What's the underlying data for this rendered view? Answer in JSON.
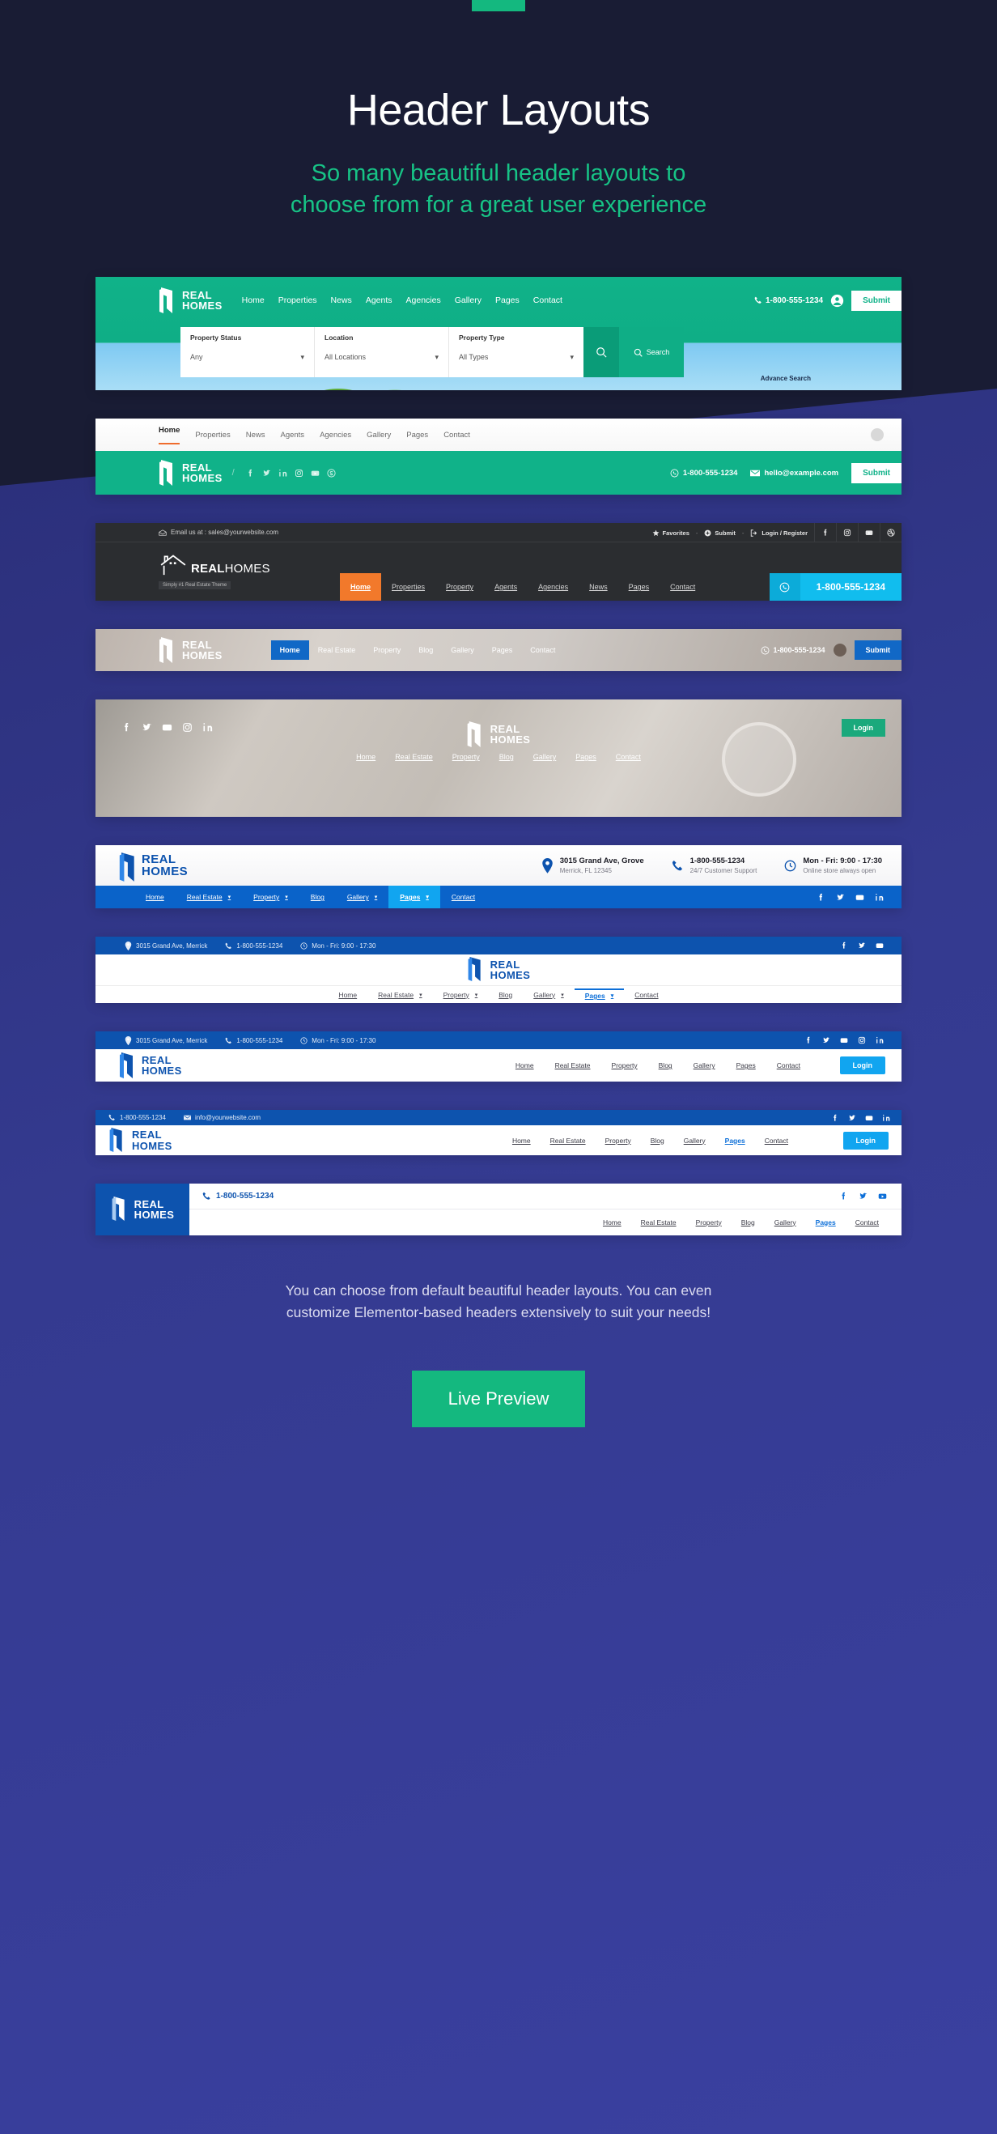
{
  "theme": {
    "accent_green": "#14b87f",
    "dark_bg": "#191c34",
    "blue_bg": "#333a92",
    "brand_blue": "#0d53ae"
  },
  "hero": {
    "title": "Header Layouts",
    "subtitle_line1": "So many beautiful header layouts to",
    "subtitle_line2": "choose from for a great user experience"
  },
  "brand": {
    "line1": "REAL",
    "line2": "HOMES",
    "full": "REALHOMES",
    "tagline": "Simply #1 Real Estate Theme"
  },
  "headers": {
    "h1": {
      "nav": [
        "Home",
        "Properties",
        "News",
        "Agents",
        "Agencies",
        "Gallery",
        "Pages",
        "Contact"
      ],
      "phone": "1-800-555-1234",
      "submit": "Submit",
      "search": {
        "fields": [
          {
            "label": "Property Status",
            "value": "Any"
          },
          {
            "label": "Location",
            "value": "All Locations"
          },
          {
            "label": "Property Type",
            "value": "All Types"
          }
        ],
        "button": "Search",
        "advance": "Advance Search"
      }
    },
    "h2": {
      "nav": [
        "Home",
        "Properties",
        "News",
        "Agents",
        "Agencies",
        "Gallery",
        "Pages",
        "Contact"
      ],
      "socials": [
        "facebook",
        "twitter",
        "linkedin",
        "instagram",
        "youtube",
        "skype"
      ],
      "phone": "1-800-555-1234",
      "email": "hello@example.com",
      "submit": "Submit"
    },
    "h3": {
      "email_label": "Email us at : sales@yourwebsite.com",
      "links": [
        "Favorites",
        "Submit",
        "Login / Register"
      ],
      "separator": "-",
      "socials": [
        "facebook",
        "instagram",
        "youtube",
        "dribbble"
      ],
      "nav": [
        "Home",
        "Properties",
        "Property",
        "Agents",
        "Agencies",
        "News",
        "Pages",
        "Contact"
      ],
      "phone": "1-800-555-1234"
    },
    "h4": {
      "nav": [
        "Home",
        "Real Estate",
        "Property",
        "Blog",
        "Gallery",
        "Pages",
        "Contact"
      ],
      "phone": "1-800-555-1234",
      "submit": "Submit"
    },
    "h5": {
      "socials": [
        "facebook",
        "twitter",
        "youtube",
        "instagram",
        "linkedin"
      ],
      "nav": [
        "Home",
        "Real Estate",
        "Property",
        "Blog",
        "Gallery",
        "Pages",
        "Contact"
      ],
      "login": "Login"
    },
    "h6": {
      "info": [
        {
          "icon": "map-pin-icon",
          "title": "3015 Grand Ave, Grove",
          "subtitle": "Merrick, FL 12345"
        },
        {
          "icon": "phone-icon",
          "title": "1-800-555-1234",
          "subtitle": "24/7 Customer Support"
        },
        {
          "icon": "clock-icon",
          "title": "Mon - Fri: 9:00 - 17:30",
          "subtitle": "Online store always open"
        }
      ],
      "nav": [
        "Home",
        "Real Estate",
        "Property",
        "Blog",
        "Gallery",
        "Pages",
        "Contact"
      ],
      "active": "Pages",
      "caret_items": [
        "Real Estate",
        "Property",
        "Gallery",
        "Pages"
      ],
      "socials": [
        "facebook",
        "twitter",
        "youtube",
        "linkedin"
      ]
    },
    "h7": {
      "topbar": [
        {
          "icon": "map-pin-icon",
          "text": "3015 Grand Ave, Merrick"
        },
        {
          "icon": "phone-icon",
          "text": "1-800-555-1234"
        },
        {
          "icon": "clock-icon",
          "text": "Mon - Fri: 9:00 - 17:30"
        }
      ],
      "socials": [
        "facebook",
        "twitter",
        "youtube"
      ],
      "nav": [
        "Home",
        "Real Estate",
        "Property",
        "Blog",
        "Gallery",
        "Pages",
        "Contact"
      ],
      "active": "Pages"
    },
    "h8": {
      "topbar": [
        {
          "icon": "map-pin-icon",
          "text": "3015 Grand Ave, Merrick"
        },
        {
          "icon": "phone-icon",
          "text": "1-800-555-1234"
        },
        {
          "icon": "clock-icon",
          "text": "Mon - Fri: 9:00 - 17:30"
        }
      ],
      "socials": [
        "facebook",
        "twitter",
        "youtube",
        "instagram",
        "linkedin"
      ],
      "nav": [
        "Home",
        "Real Estate",
        "Property",
        "Blog",
        "Gallery",
        "Pages",
        "Contact"
      ],
      "login": "Login"
    },
    "h9": {
      "topbar": [
        {
          "icon": "phone-icon",
          "text": "1-800-555-1234"
        },
        {
          "icon": "mail-icon",
          "text": "info@yourwebsite.com"
        }
      ],
      "socials": [
        "facebook",
        "twitter",
        "youtube",
        "linkedin"
      ],
      "nav": [
        "Home",
        "Real Estate",
        "Property",
        "Blog",
        "Gallery",
        "Pages",
        "Contact"
      ],
      "active": "Pages",
      "login": "Login"
    },
    "h10": {
      "phone": "1-800-555-1234",
      "socials": [
        "facebook",
        "twitter",
        "youtube"
      ],
      "nav": [
        "Home",
        "Real Estate",
        "Property",
        "Blog",
        "Gallery",
        "Pages",
        "Contact"
      ],
      "active": "Pages"
    }
  },
  "outro": {
    "line1": "You can choose from default beautiful header layouts. You can even",
    "line2": "customize Elementor-based headers extensively to suit your needs!",
    "cta": "Live Preview"
  }
}
